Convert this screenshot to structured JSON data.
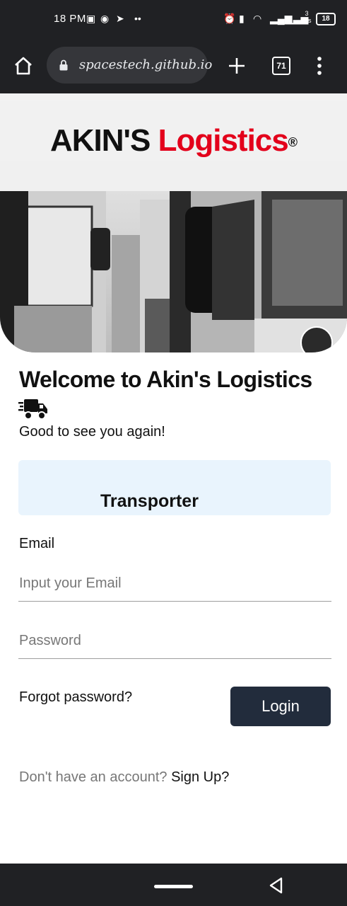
{
  "status_bar": {
    "time": "18 PM",
    "battery": "18",
    "net_speed": "3 K/s"
  },
  "browser": {
    "url": "spacestech.github.io",
    "tab_count": "71"
  },
  "hero": {
    "brand_primary": "AKIN'S",
    "brand_secondary": "Logistics",
    "brand_mark": "®"
  },
  "welcome": {
    "title": "Welcome to Akin's Logistics",
    "subtitle": "Good to see you again!",
    "icon": "delivery-truck-icon"
  },
  "role": {
    "selected": "Transporter"
  },
  "form": {
    "email_label": "Email",
    "email_placeholder": "Input your Email",
    "email_value": "",
    "password_placeholder": "Password",
    "password_value": "",
    "forgot_label": "Forgot password?",
    "login_label": "Login"
  },
  "signup": {
    "prompt": "Don't have an account?",
    "link": "Sign Up?"
  },
  "colors": {
    "brand_red": "#e3001b",
    "button_bg": "#222c3c",
    "role_bg": "#e9f4fd",
    "chrome_bg": "#202124"
  }
}
